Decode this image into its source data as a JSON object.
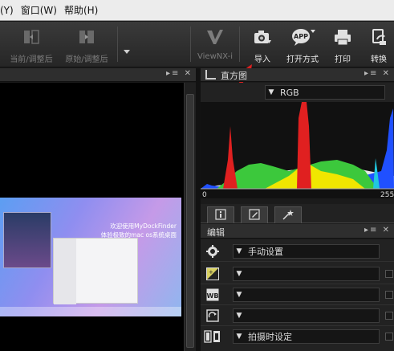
{
  "menu": {
    "items": [
      "(Y)",
      "窗口(W)",
      "帮助(H)"
    ]
  },
  "toolbar": {
    "current_adjusted": "当前/调整后",
    "original_adjusted": "原始/调整后",
    "viewnx": "ViewNX-i",
    "import": "导入",
    "open_with": "打开方式",
    "print": "打印",
    "convert": "转换"
  },
  "histogram": {
    "title": "直方图",
    "channel": "RGB",
    "axis_min": "0",
    "axis_max": "255"
  },
  "screenshot_preview": {
    "line1": "欢迎使用MyDockFinder",
    "line2": "体验极致的mac os系统桌面"
  },
  "edit": {
    "title": "编辑",
    "rows": [
      {
        "icon": "gear-icon",
        "value": "手动设置"
      },
      {
        "icon": "exposure-icon",
        "value": ""
      },
      {
        "icon": "white-balance-icon",
        "value": ""
      },
      {
        "icon": "picture-control-icon",
        "value": ""
      },
      {
        "icon": "camera-settings-icon",
        "value": "拍摄时设定"
      }
    ]
  },
  "colors": {
    "accent_red": "#e02020",
    "histogram_green": "#3cc83c",
    "histogram_yellow": "#f0e600",
    "histogram_blue": "#2050ff"
  }
}
